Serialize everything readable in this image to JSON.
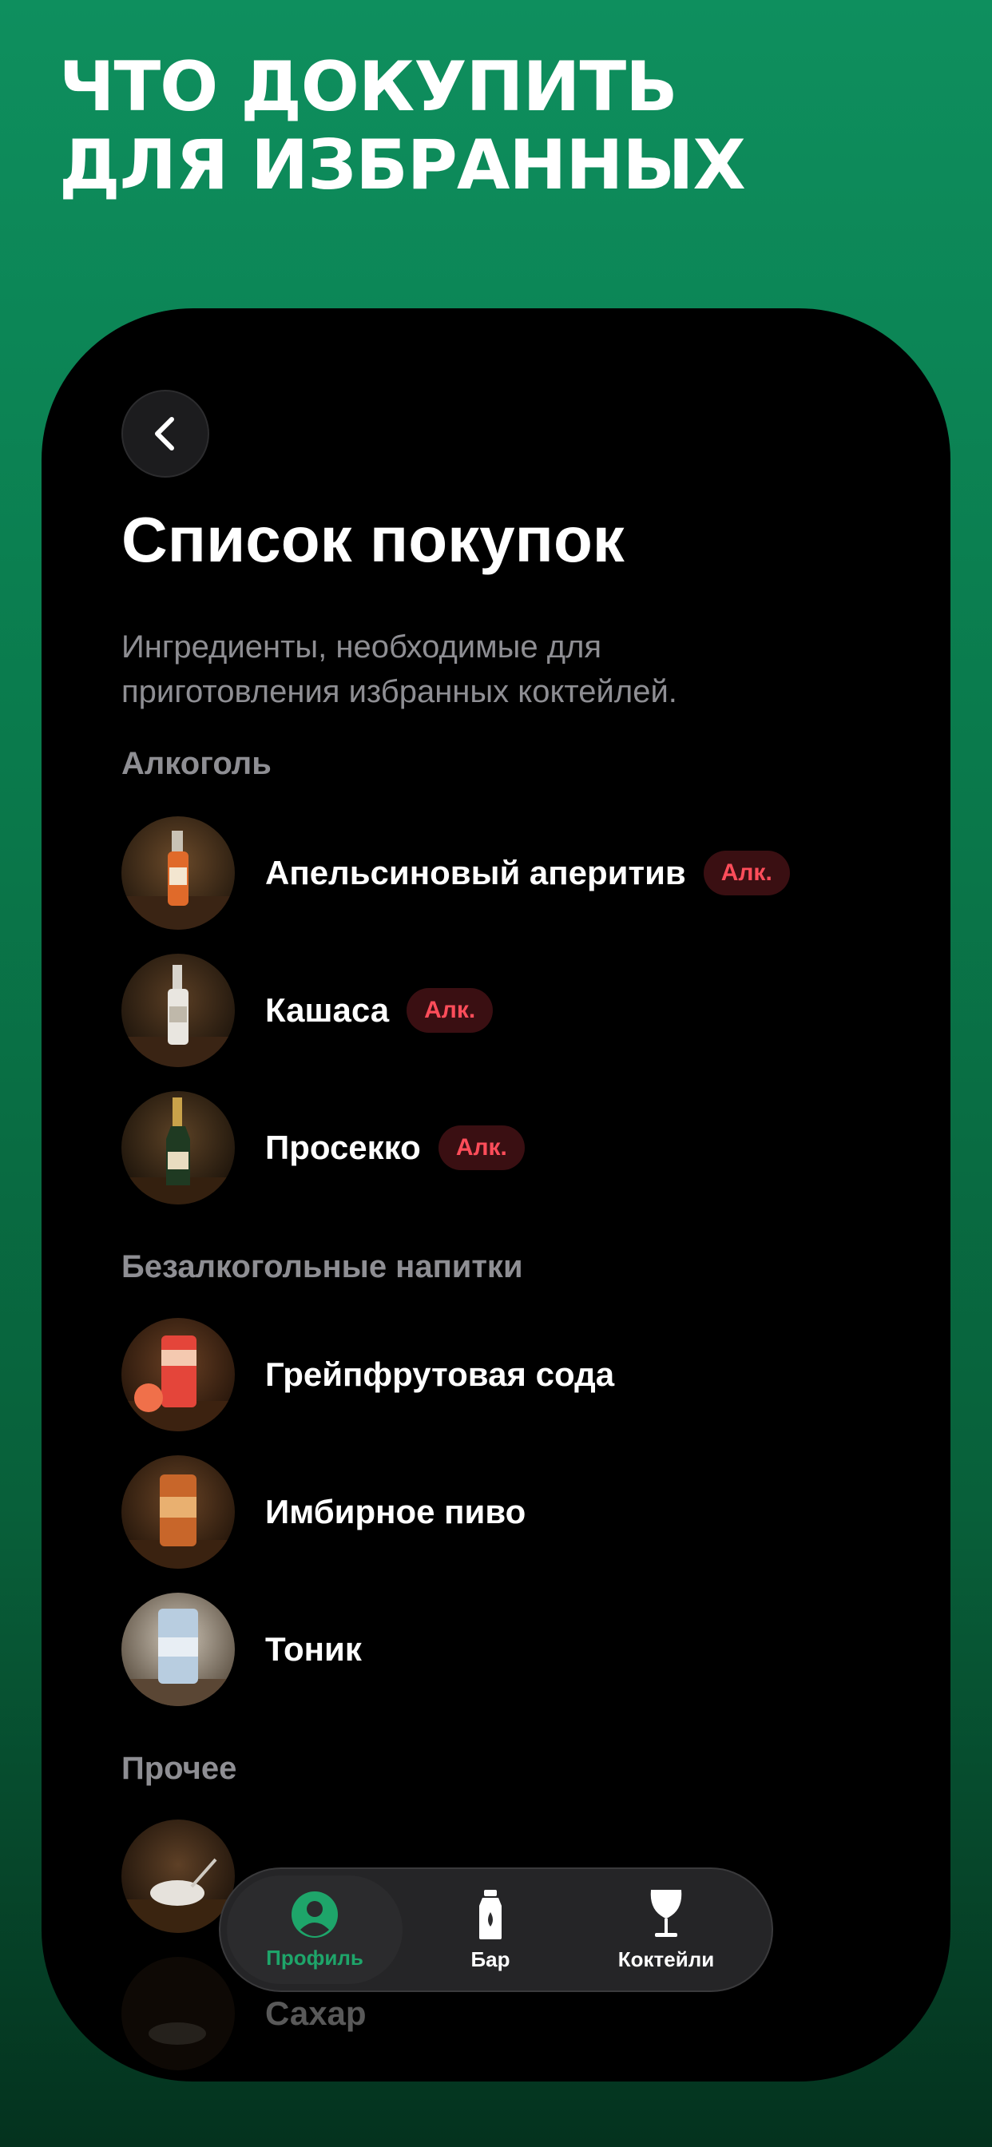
{
  "promo": {
    "line1": "ЧТО ДОКУПИТЬ",
    "line2": "ДЛЯ ИЗБРАННЫХ"
  },
  "header": {
    "back_icon": "chevron-left-icon",
    "title": "Список покупок",
    "subtitle": "Ингредиенты, необходимые для приготовления избранных коктейлей."
  },
  "sections": [
    {
      "title": "Алкоголь",
      "items": [
        {
          "name": "Апельсиновый аперитив",
          "badge": "Алк."
        },
        {
          "name": "Кашаса",
          "badge": "Алк."
        },
        {
          "name": "Просекко",
          "badge": "Алк."
        }
      ]
    },
    {
      "title": "Безалкогольные напитки",
      "items": [
        {
          "name": "Грейпфрутовая сода"
        },
        {
          "name": "Имбирное пиво"
        },
        {
          "name": "Тоник"
        }
      ]
    },
    {
      "title": "Прочее",
      "items": [
        {
          "name": "Сахар"
        }
      ]
    }
  ],
  "tabbar": {
    "tabs": [
      {
        "label": "Профиль",
        "icon": "profile-icon",
        "active": true
      },
      {
        "label": "Бар",
        "icon": "bottle-icon",
        "active": false
      },
      {
        "label": "Коктейли",
        "icon": "wine-glass-icon",
        "active": false
      }
    ]
  },
  "colors": {
    "accent": "#1ea56a",
    "badge_text": "#ff4d5a",
    "badge_bg": "#3a0f12",
    "background_top": "#0e8f5e"
  }
}
